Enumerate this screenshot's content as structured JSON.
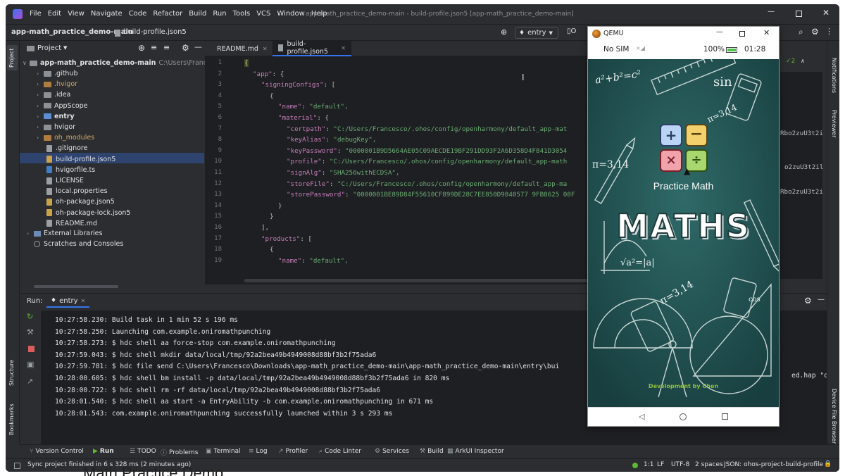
{
  "menubar": {
    "items": [
      "File",
      "Edit",
      "View",
      "Navigate",
      "Code",
      "Refactor",
      "Build",
      "Run",
      "Tools",
      "VCS",
      "Window",
      "Help"
    ],
    "window_title": "app-math_practice_demo-main - build-profile.json5 [app-math_practice_demo-main]"
  },
  "navbar": {
    "breadcrumb_root": "app-math_practice_demo-main",
    "breadcrumb_file": "build-profile.json5",
    "run_config": "entry",
    "run_config_partial": "O"
  },
  "project": {
    "header": "Project",
    "root_name": "app-math_practice_demo-main",
    "root_path": "C:\\Users\\Francesco\\Do",
    "items": [
      {
        "label": ".github",
        "kind": "folder"
      },
      {
        "label": ".hvigor",
        "kind": "folder-orange"
      },
      {
        "label": ".idea",
        "kind": "folder"
      },
      {
        "label": "AppScope",
        "kind": "folder"
      },
      {
        "label": "entry",
        "kind": "folder-blue"
      },
      {
        "label": "hvigor",
        "kind": "folder"
      },
      {
        "label": "oh_modules",
        "kind": "folder-orange"
      },
      {
        "label": ".gitignore",
        "kind": "file"
      },
      {
        "label": "build-profile.json5",
        "kind": "json"
      },
      {
        "label": "hvigorfile.ts",
        "kind": "ts"
      },
      {
        "label": "LICENSE",
        "kind": "file"
      },
      {
        "label": "local.properties",
        "kind": "file"
      },
      {
        "label": "oh-package.json5",
        "kind": "json"
      },
      {
        "label": "oh-package-lock.json5",
        "kind": "json"
      },
      {
        "label": "README.md",
        "kind": "file"
      }
    ],
    "external_libraries": "External Libraries",
    "scratches": "Scratches and Consoles"
  },
  "editor": {
    "tabs": [
      {
        "label": "README.md",
        "active": false
      },
      {
        "label": "build-profile.json5",
        "active": true
      }
    ],
    "line_numbers": [
      "1",
      "2",
      "3",
      "4",
      "5",
      "6",
      "7",
      "8",
      "9",
      "10",
      "11",
      "12",
      "13",
      "14",
      "15",
      "16",
      "17",
      "18",
      "19"
    ],
    "lines": [
      {
        "indent": 0,
        "text": "{"
      },
      {
        "indent": 1,
        "key": "\"app\"",
        "rest": ": {"
      },
      {
        "indent": 2,
        "key": "\"signingConfigs\"",
        "rest": ": ["
      },
      {
        "indent": 3,
        "text": "{"
      },
      {
        "indent": 4,
        "key": "\"name\"",
        "rest": ": ",
        "val": "\"default\","
      },
      {
        "indent": 4,
        "key": "\"material\"",
        "rest": ": {"
      },
      {
        "indent": 5,
        "key": "\"certpath\"",
        "rest": ": ",
        "val": "\"C:/Users/Francesco/.ohos/config/openharmony/default_app-mat"
      },
      {
        "indent": 5,
        "key": "\"keyAlias\"",
        "rest": ": ",
        "val": "\"debugKey\","
      },
      {
        "indent": 5,
        "key": "\"keyPassword\"",
        "rest": ": ",
        "val": "\"0000001B9D5664AE05C09AECDE19BF291DD93F2A6D358D4F841D3054"
      },
      {
        "indent": 5,
        "key": "\"profile\"",
        "rest": ": ",
        "val": "\"C:/Users/Francesco/.ohos/config/openharmony/default_app-math"
      },
      {
        "indent": 5,
        "key": "\"signAlg\"",
        "rest": ": ",
        "val": "\"SHA256withECDSA\","
      },
      {
        "indent": 5,
        "key": "\"storeFile\"",
        "rest": ": ",
        "val": "\"C:/Users/Francesco/.ohos/config/openharmony/default_app-ma"
      },
      {
        "indent": 5,
        "key": "\"storePassword\"",
        "rest": ": ",
        "val": "\"0000001BE89D84F55610CF899DE28C7EE850D9840577 9FB8625 08F"
      },
      {
        "indent": 4,
        "text": "}"
      },
      {
        "indent": 3,
        "text": "}"
      },
      {
        "indent": 2,
        "text": "],"
      },
      {
        "indent": 2,
        "key": "\"products\"",
        "rest": ": ["
      },
      {
        "indent": 3,
        "text": "{"
      },
      {
        "indent": 4,
        "key": "\"name\"",
        "rest": ": ",
        "val": "\"default\","
      }
    ],
    "overflow_right": [
      "Rbo2zuU3t2i",
      "o2zuU3t2il",
      "Rbo2zuU3t2i"
    ],
    "inspection": "2"
  },
  "run": {
    "label": "Run:",
    "config": "entry",
    "lines": [
      "10:27:58.230: Build task in 1 min 52 s 196 ms",
      "10:27:58.250: Launching com.example.oniromathpunching",
      "10:27:58.273: $ hdc shell aa force-stop com.example.oniromathpunching",
      "10:27:59.043: $ hdc shell mkdir data/local/tmp/92a2bea49b4949008d88bf3b2f75ada6",
      "10:27:59.781: $ hdc file send C:\\Users\\Francesco\\Downloads\\app-math_practice_demo-main\\app-math_practice_demo-main\\entry\\bui",
      "10:28:00.605: $ hdc shell bm install -p data/local/tmp/92a2bea49b4949008d88bf3b2f75ada6  in 820 ms",
      "10:28:00.722: $ hdc shell rm -rf data/local/tmp/92a2bea49b4949008d88bf3b2f75ada6",
      "10:28:01.540: $ hdc shell aa start -a EntryAbility -b com.example.oniromathpunching in 671 ms",
      "10:28:01.543: com.example.oniromathpunching successfully launched within 3 s 293 ms"
    ],
    "overflow_right": "ed.hap \"dat"
  },
  "bottom_tabs": [
    "Version Control",
    "Run",
    "TODO",
    "Problems",
    "Terminal",
    "Log",
    "Profiler",
    "Code Linter",
    "Services",
    "Build",
    "ArkUI Inspector"
  ],
  "status": {
    "message": "Sync project finished in 6 s 328 ms (2 minutes ago)",
    "position": "1:1",
    "line_sep": "LF",
    "encoding": "UTF-8",
    "indent": "2 spaces",
    "schema": "JSON: ohos-project-build-profile"
  },
  "left_strip": [
    "Project",
    "Structure",
    "Bookmarks"
  ],
  "right_strip": [
    "Notifications",
    "Previewer",
    "Device File Browser"
  ],
  "qemu": {
    "title": "QEMU",
    "carrier": "No SIM",
    "battery": "100%",
    "time": "01:28",
    "app_title": "Practice Math",
    "banner": "MATHS",
    "developer": "Development by Chen",
    "chalk": [
      "a²+b²=c²",
      "π=3,14",
      "π=3,14",
      "√a²=|a|",
      "π=3,14",
      "sin",
      "cos"
    ]
  },
  "bottom_caption": "Math Practice Demo",
  "colors": {
    "accent": "#3574f0",
    "bg": "#2b2d30",
    "editor_bg": "#1e1f22",
    "green": "#5fb832"
  }
}
